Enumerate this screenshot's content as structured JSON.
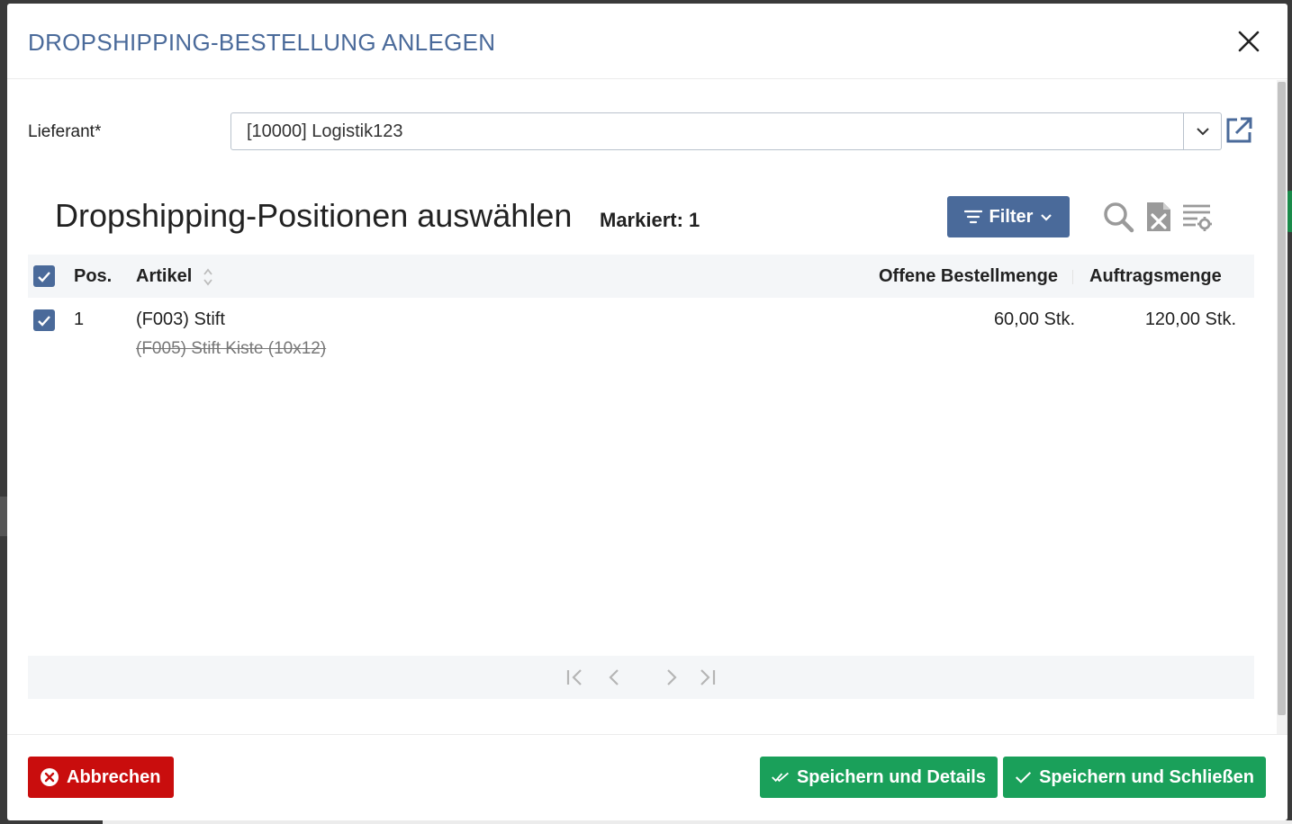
{
  "modal": {
    "title": "DROPSHIPPING-BESTELLUNG ANLEGEN"
  },
  "form": {
    "supplier_label": "Lieferant*",
    "supplier_value": "[10000] Logistik123"
  },
  "section": {
    "title": "Dropshipping-Positionen auswählen",
    "marked": "Markiert: 1",
    "filter_label": "Filter"
  },
  "table": {
    "columns": [
      "Pos.",
      "Artikel",
      "Offene Bestellmenge",
      "Auftragsmenge"
    ],
    "rows": [
      {
        "pos": "1",
        "article": "(F003) Stift",
        "article_replaced": "(F005) Stift Kiste (10x12)",
        "open_qty": "60,00 Stk.",
        "order_qty": "120,00 Stk."
      }
    ]
  },
  "footer": {
    "cancel_label": "Abbrechen",
    "save_details_label": "Speichern und Details",
    "save_close_label": "Speichern und Schließen"
  },
  "colors": {
    "primary": "#4a6a9a",
    "danger": "#c90d0d",
    "success": "#1aa05a"
  }
}
